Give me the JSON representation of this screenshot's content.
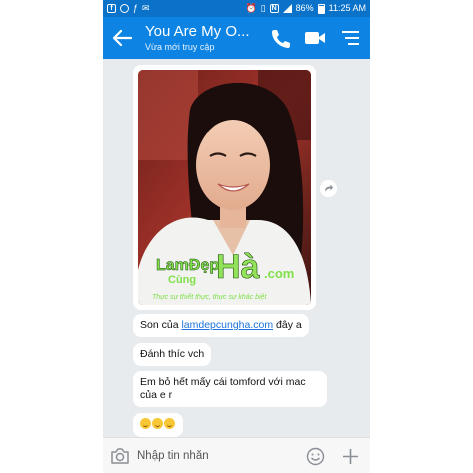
{
  "status_bar": {
    "battery": "86%",
    "time": "11:25 AM",
    "left_icons": [
      "facebook-icon",
      "instagram-icon",
      "at-sign-icon",
      "mail-icon"
    ],
    "right_icons": [
      "alarm-icon",
      "vibrate-icon",
      "nfc-icon",
      "signal-icon",
      "battery-icon"
    ]
  },
  "header": {
    "title": "You Are My O...",
    "subtitle": "Vừa mới truy cập",
    "actions": [
      "back-icon",
      "phone-icon",
      "video-camera-icon",
      "menu-icon"
    ]
  },
  "photo_message": {
    "watermark_brand": "LamDepCungHa.com",
    "watermark_tagline": "Thực sự thiết thực, thực sự khác biệt"
  },
  "messages": [
    {
      "prefix": "Son của ",
      "link": "lamdepcungha.com",
      "suffix": " đây a"
    },
    {
      "text": "Đánh thíc vch"
    },
    {
      "text": "Em bỏ hết mấy cái tomford với mac của e r"
    },
    {
      "emojis": [
        "grinning-sweat-emoji",
        "grinning-sweat-emoji",
        "grinning-sweat-emoji"
      ]
    }
  ],
  "composer": {
    "placeholder": "Nhập tin nhắn"
  },
  "colors": {
    "status_bar": "#0a72c9",
    "app_bar": "#0d84e3",
    "chat_background": "#e8ebee",
    "bubble": "#ffffff",
    "link": "#1a73d9"
  }
}
